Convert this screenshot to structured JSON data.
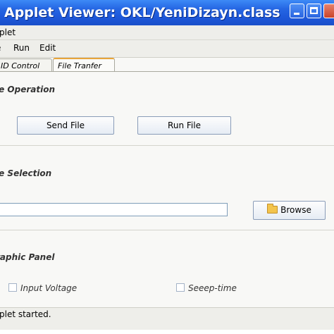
{
  "window": {
    "title": "Applet Viewer: OKL/YeniDizayn.class"
  },
  "applet_menu": {
    "label": "plet"
  },
  "menubar": {
    "items": [
      "e",
      "Run",
      "Edit"
    ]
  },
  "tabs": [
    {
      "label": "ID Control",
      "selected": false
    },
    {
      "label": "File Tranfer",
      "selected": true
    }
  ],
  "file_operation": {
    "title": "le Operation",
    "send_label": "Send File",
    "run_label": "Run File"
  },
  "file_selection": {
    "title": "le Selection",
    "path_value": "",
    "browse_label": "Browse",
    "browse_icon": "folder-icon"
  },
  "graphic_panel": {
    "title": "raphic Panel",
    "options": [
      {
        "label": "Input Voltage",
        "checked": false
      },
      {
        "label": "Seeep-time",
        "checked": false
      }
    ]
  },
  "status": {
    "text": "plet started."
  },
  "colors": {
    "titlebar": "#2566e3",
    "background": "#eeeeea",
    "tab_accent": "#e8a53a"
  }
}
